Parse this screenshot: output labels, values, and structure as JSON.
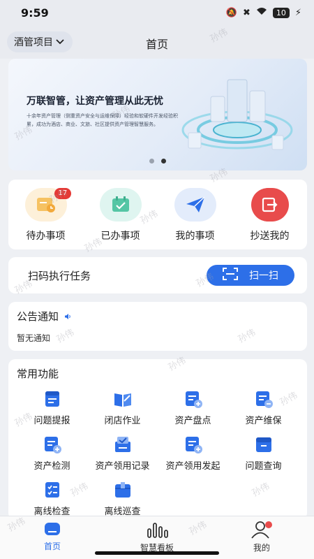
{
  "status": {
    "time": "9:59",
    "battery": "10"
  },
  "header": {
    "project": "酒管项目",
    "title": "首页"
  },
  "banner": {
    "title": "万联智管，让资产管理从此无忧",
    "subtitle": "十余年资产管理（侧重资产安全与运维保障）经验和软硬件开发经验积累，成功为酒店、商业、文旅、社区提供资产管理智慧服务。"
  },
  "quick": [
    {
      "label": "待办事项",
      "badge": "17",
      "icon": "todo-clock-icon"
    },
    {
      "label": "已办事项",
      "icon": "calendar-check-icon"
    },
    {
      "label": "我的事项",
      "icon": "paper-plane-icon"
    },
    {
      "label": "抄送我的",
      "icon": "forward-icon"
    }
  ],
  "scan": {
    "text": "扫码执行任务",
    "button": "扫一扫"
  },
  "notice": {
    "title": "公告通知",
    "empty": "暂无通知"
  },
  "functions": {
    "title": "常用功能",
    "items": [
      {
        "label": "问题提报",
        "icon": "form-list-icon"
      },
      {
        "label": "闭店作业",
        "icon": "open-book-icon"
      },
      {
        "label": "资产盘点",
        "icon": "asset-add-icon"
      },
      {
        "label": "资产维保",
        "icon": "asset-maint-icon"
      },
      {
        "label": "资产检测",
        "icon": "asset-check-icon"
      },
      {
        "label": "资产领用记录",
        "icon": "box-check-icon"
      },
      {
        "label": "资产领用发起",
        "icon": "asset-launch-icon"
      },
      {
        "label": "问题查询",
        "icon": "archive-icon"
      },
      {
        "label": "离线检查",
        "icon": "checklist-icon"
      },
      {
        "label": "离线巡查",
        "icon": "box-icon"
      }
    ]
  },
  "tabs": [
    {
      "label": "首页",
      "icon": "home-icon"
    },
    {
      "label": "智慧看板",
      "icon": "chart-bars-icon"
    },
    {
      "label": "我的",
      "icon": "user-icon"
    }
  ],
  "watermark": "孙伟",
  "colors": {
    "primary": "#2d6fe8",
    "badge": "#e53935",
    "red_button": "#e84b4b"
  }
}
